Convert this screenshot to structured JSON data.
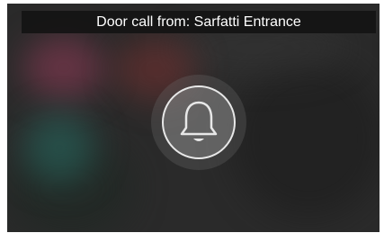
{
  "call": {
    "title": "Door call from: Sarfatti Entrance"
  },
  "bell_button": {
    "icon": "bell-icon"
  },
  "colors": {
    "title_bar_bg": "#121212",
    "title_text": "#ffffff",
    "icon_stroke": "#e8e8e8"
  }
}
